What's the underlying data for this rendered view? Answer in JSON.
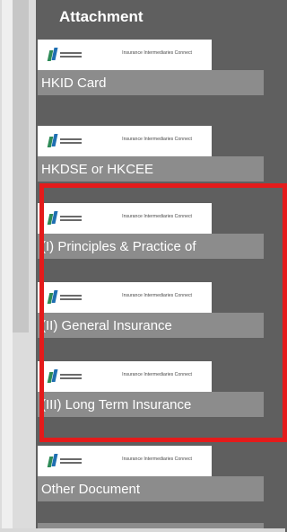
{
  "panel": {
    "title": "Attachment"
  },
  "attachments": [
    {
      "label": "HKID Card",
      "brand": "Insurance Intermediaries Connect"
    },
    {
      "label": "HKDSE or HKCEE",
      "brand": "Insurance Intermediaries Connect"
    },
    {
      "label": "(I) Principles & Practice of",
      "brand": "Insurance Intermediaries Connect"
    },
    {
      "label": "(II) General Insurance",
      "brand": "Insurance Intermediaries Connect"
    },
    {
      "label": "(III) Long Term Insurance",
      "brand": "Insurance Intermediaries Connect"
    },
    {
      "label": "Other Document",
      "brand": "Insurance Intermediaries Connect"
    }
  ],
  "colors": {
    "highlight": "#e41b1b",
    "panel": "#5f5f5f",
    "label_bg": "#8c8c8c"
  }
}
